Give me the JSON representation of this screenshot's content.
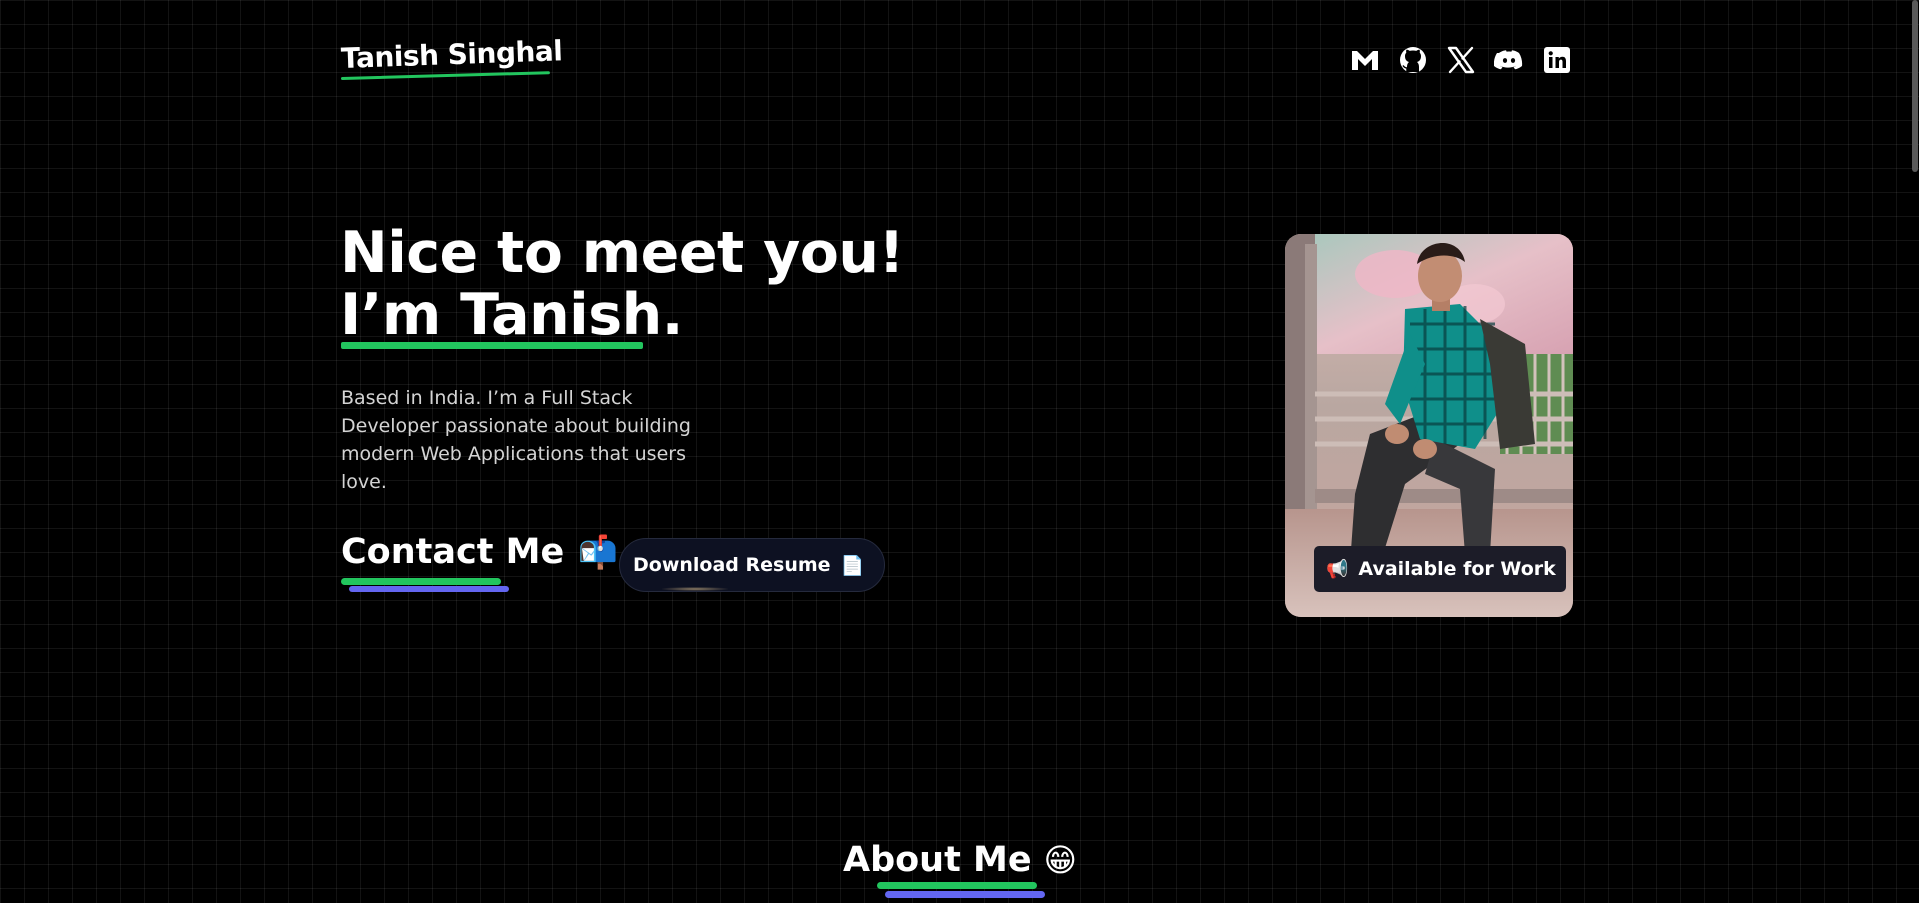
{
  "header": {
    "logo_text": "Tanish Singhal",
    "accent_color": "#22c55e",
    "social_links": [
      {
        "icon": "gmail-icon"
      },
      {
        "icon": "github-icon"
      },
      {
        "icon": "x-twitter-icon"
      },
      {
        "icon": "discord-icon"
      },
      {
        "icon": "linkedin-icon"
      }
    ]
  },
  "hero": {
    "title_line_1": "Nice to meet you!",
    "title_line_2": "I’m Tanish.",
    "bio": "Based in India. I’m a Full Stack Developer passionate about building modern Web Applications that users love.",
    "contact_label": "Contact Me",
    "contact_emoji": "📬",
    "resume_label": "Download Resume",
    "resume_emoji": "📄",
    "secondary_accent_color": "#6366f1"
  },
  "photo": {
    "badge_emoji": "📢",
    "badge_label": "Available for Work"
  },
  "about": {
    "title": "About Me",
    "emoji": "😁"
  }
}
